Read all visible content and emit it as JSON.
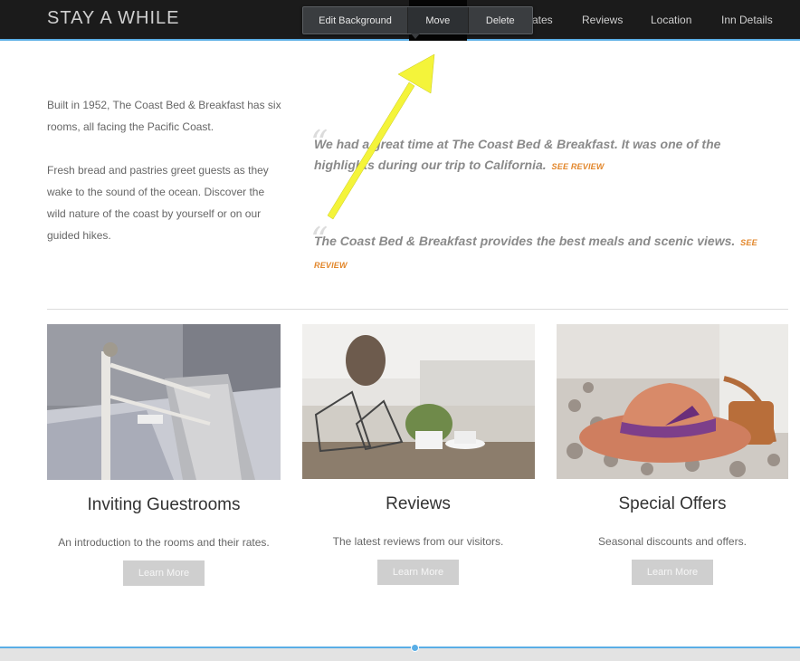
{
  "header": {
    "brand": "STAY A WHILE",
    "nav": [
      "ates",
      "Reviews",
      "Location",
      "Inn Details"
    ]
  },
  "toolbar": {
    "edit_background": "Edit Background",
    "move": "Move",
    "delete": "Delete"
  },
  "intro": {
    "p1": "Built in 1952, The Coast Bed & Breakfast has six rooms, all facing the Pacific Coast.",
    "p2": "Fresh bread and pastries greet guests as they wake to the sound of the ocean. Discover the wild nature of the coast by yourself or on our guided hikes."
  },
  "quotes": [
    {
      "text": "We had a great time at The Coast Bed & Breakfast. It was one of the highlights during our trip to California.",
      "link": "SEE REVIEW"
    },
    {
      "text": "The Coast Bed & Breakfast provides the best meals and scenic views.",
      "link": "SEE REVIEW"
    }
  ],
  "cards": [
    {
      "title": "Inviting Guestrooms",
      "desc": "An introduction to the rooms and their rates.",
      "button": "Learn More"
    },
    {
      "title": "Reviews",
      "desc": "The latest reviews from our visitors.",
      "button": "Learn More"
    },
    {
      "title": "Special Offers",
      "desc": "Seasonal discounts and offers.",
      "button": "Learn More"
    }
  ],
  "colors": {
    "accent": "#5aaee6",
    "link": "#e2862a",
    "arrow": "#f4f43a"
  }
}
